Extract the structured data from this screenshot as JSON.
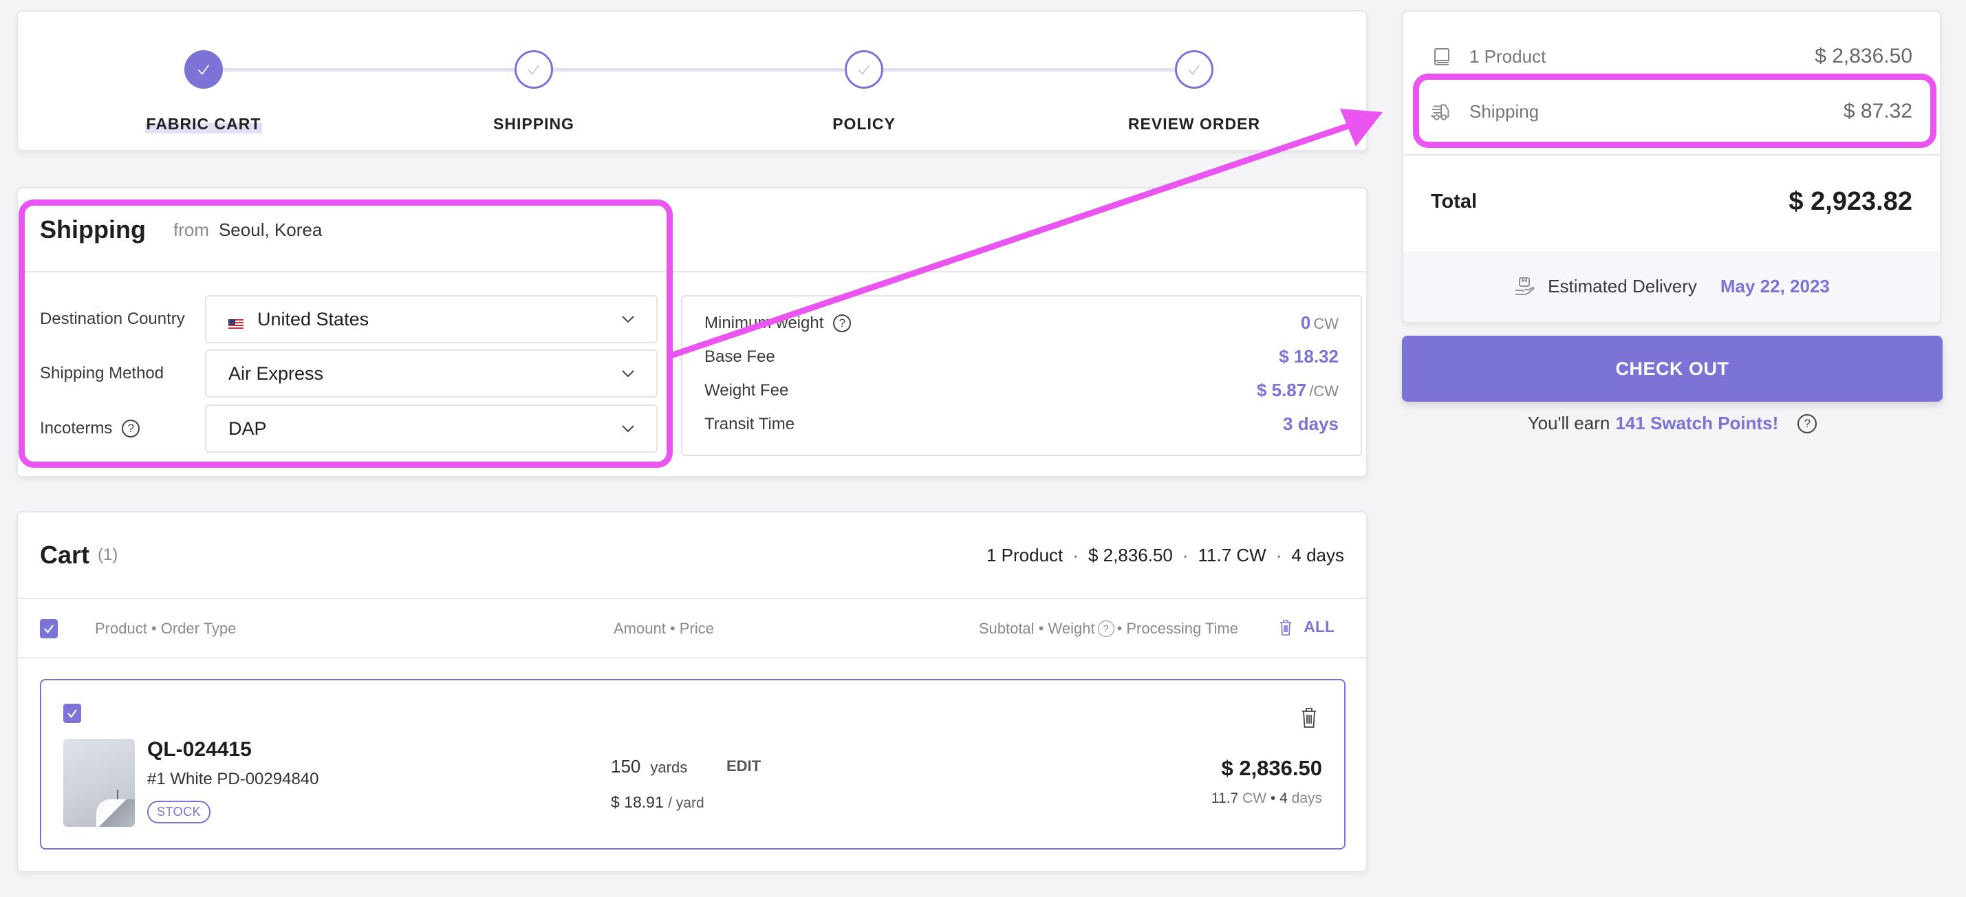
{
  "stepper": {
    "steps": [
      {
        "label": "FABRIC CART",
        "state": "active"
      },
      {
        "label": "SHIPPING",
        "state": "pending"
      },
      {
        "label": "POLICY",
        "state": "pending"
      },
      {
        "label": "REVIEW ORDER",
        "state": "pending"
      }
    ]
  },
  "shipping": {
    "title": "Shipping",
    "from_label": "from",
    "origin": "Seoul, Korea",
    "fields": {
      "destination_country": {
        "label": "Destination Country",
        "value": "United States",
        "flag": "us-flag-icon"
      },
      "shipping_method": {
        "label": "Shipping Method",
        "value": "Air Express"
      },
      "incoterms": {
        "label": "Incoterms",
        "value": "DAP",
        "help": "?"
      }
    },
    "fees": {
      "minimum_weight": {
        "label": "Minimum weight",
        "value": "0",
        "unit": "CW"
      },
      "base_fee": {
        "label": "Base Fee",
        "value": "$ 18.32"
      },
      "weight_fee": {
        "label": "Weight Fee",
        "value": "$ 5.87",
        "unit": "/CW"
      },
      "transit_time": {
        "label": "Transit Time",
        "value": "3 days"
      }
    }
  },
  "cart": {
    "title": "Cart",
    "count": "(1)",
    "summary": {
      "products": "1 Product",
      "amount": "$ 2,836.50",
      "weight": "11.7 CW",
      "days": "4 days",
      "separator": "·"
    },
    "columns": {
      "product": "Product • Order Type",
      "amount": "Amount • Price",
      "subtotal_a": "Subtotal • Weight",
      "subtotal_b": "• Processing Time",
      "delete_all": "ALL"
    },
    "items": [
      {
        "code": "QL-024415",
        "name": "#1 White PD-00294840",
        "badge": "STOCK",
        "quantity": "150",
        "quantity_unit": "yards",
        "edit_label": "EDIT",
        "price": "$ 18.91",
        "price_unit": "/ yard",
        "subtotal": "$ 2,836.50",
        "weight": "11.7",
        "weight_unit": "CW",
        "processing": "4",
        "processing_unit": "days",
        "checked": true
      }
    ]
  },
  "summary": {
    "product_label": "1 Product",
    "product_value": "$ 2,836.50",
    "shipping_label": "Shipping",
    "shipping_value": "$ 87.32",
    "total_label": "Total",
    "total_value": "$ 2,923.82",
    "delivery_label": "Estimated Delivery",
    "delivery_date": "May 22, 2023",
    "checkout_label": "CHECK OUT",
    "points_prefix": "You'll earn",
    "points_highlight": "141 Swatch Points!"
  },
  "colors": {
    "accent": "#7b73d6",
    "accent_light": "#e2e0f6",
    "annotation": "#ea55f1",
    "background": "#f4f4f6"
  }
}
